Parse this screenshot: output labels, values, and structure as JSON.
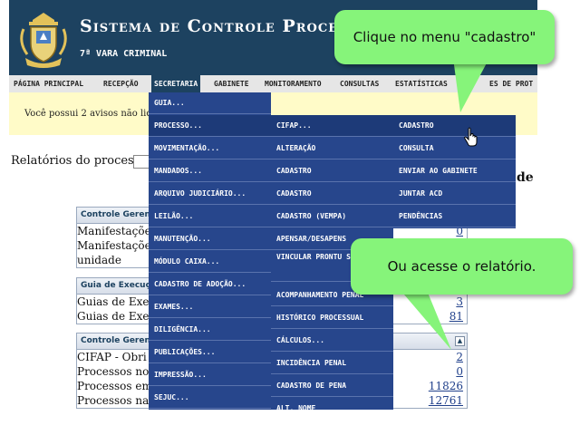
{
  "header": {
    "title": "Sistema de Controle Processu",
    "subtitle": "7ª VARA CRIMINAL",
    "logo_icon": "coat-of-arms-icon"
  },
  "menubar": {
    "items": [
      {
        "label": "PÁGINA PRINCIPAL"
      },
      {
        "label": "RECEPÇÃO"
      },
      {
        "label": "SECRETARIA"
      },
      {
        "label": "GABINETE"
      },
      {
        "label": "MONITORAMENTO"
      },
      {
        "label": "CONSULTAS"
      },
      {
        "label": "ESTATÍSTICAS"
      },
      {
        "label": "ES DE PROT"
      }
    ],
    "active": "SECRETARIA"
  },
  "notice": {
    "text": "Você possui 2 avisos não lido"
  },
  "reports": {
    "label": "Relatórios do processo",
    "right_title": "de"
  },
  "panels": {
    "gerencial1": {
      "title": "Controle Gerenc",
      "rows": [
        {
          "label": "Manifestações",
          "value": "0"
        },
        {
          "label": "Manifestações",
          "value": ""
        },
        {
          "label": "unidade",
          "value": ""
        }
      ]
    },
    "execucao": {
      "title": "Guia de Execuç",
      "rows": [
        {
          "label": "Guias de Exec",
          "value": "3"
        },
        {
          "label": "Guias de Exec",
          "value": "81"
        }
      ]
    },
    "gerencial2": {
      "title": "Controle Geren",
      "rows": [
        {
          "label": "CIFAP - Obri",
          "value": "2"
        },
        {
          "label": "Processos no",
          "value": "0"
        },
        {
          "label": "Processos em",
          "value": "11826"
        },
        {
          "label": "Processos na S",
          "value": "12761"
        }
      ]
    }
  },
  "menu_col1": [
    "GUIA...",
    "PROCESSO...",
    "MOVIMENTAÇÃO...",
    "MANDADOS...",
    "ARQUIVO JUDICIÁRIO...",
    "LEILÃO...",
    "MANUTENÇÃO...",
    "MÓDULO CAIXA...",
    "CADASTRO DE ADOÇÃO...",
    "EXAMES...",
    "DILIGÊNCIA...",
    "PUBLICAÇÕES...",
    "IMPRESSÃO...",
    "SEJUC..."
  ],
  "menu_col2": [
    "CIFAP...",
    "ALTERAÇÃO",
    "CADASTRO",
    "CADASTRO",
    "CADASTRO (VEMPA)",
    "APENSAR/DESAPENS",
    "VINCULAR PRONTU SAP",
    "ACOMPANHAMENTO PENAL",
    "HISTÓRICO PROCESSUAL",
    "CÁLCULOS...",
    "INCIDÊNCIA PENAL",
    "CADASTRO DE PENA",
    "ALT. NOME"
  ],
  "menu_col3": [
    "CADASTRO",
    "CONSULTA",
    "ENVIAR AO GABINETE",
    "JUNTAR ACD",
    "PENDÊNCIAS"
  ],
  "callouts": {
    "top": "Clique no menu \"cadastro\"",
    "bottom": "Ou acesse o relatório."
  },
  "colors": {
    "header_bg": "#1d4260",
    "menu_bg": "#27468c",
    "callout_bg": "#86f47a",
    "notice_bg": "#fffbc8"
  },
  "icons": {
    "cursor": "hand-pointer-icon",
    "collapse": "collapse-icon"
  }
}
